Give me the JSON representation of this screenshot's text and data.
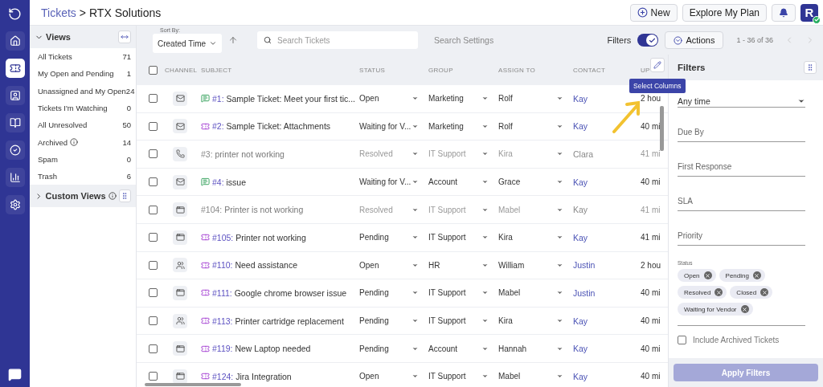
{
  "breadcrumb": {
    "parent": "Tickets",
    "separator": ">",
    "current": "RTX Solutions"
  },
  "header": {
    "new_button": "New",
    "plan_button": "Explore My Plan",
    "avatar": "R",
    "online": true
  },
  "rail": [
    {
      "kind": "home",
      "selected": false
    },
    {
      "kind": "tickets",
      "selected": true
    },
    {
      "kind": "contacts",
      "selected": false
    },
    {
      "kind": "book",
      "selected": false
    },
    {
      "kind": "tasks",
      "selected": false
    },
    {
      "kind": "reports",
      "selected": false
    },
    {
      "kind": "settings",
      "selected": false
    }
  ],
  "views": {
    "title": "Views",
    "expanded": true,
    "items": [
      {
        "label": "All Tickets",
        "count": "71",
        "info": false
      },
      {
        "label": "My Open and Pending",
        "count": "1",
        "info": false
      },
      {
        "label": "Unassigned and My Open",
        "count": "24",
        "info": false
      },
      {
        "label": "Tickets I'm Watching",
        "count": "0",
        "info": false
      },
      {
        "label": "All Unresolved",
        "count": "50",
        "info": false
      },
      {
        "label": "Archived",
        "count": "14",
        "info": true
      },
      {
        "label": "Spam",
        "count": "0",
        "info": false
      },
      {
        "label": "Trash",
        "count": "6",
        "info": false
      }
    ],
    "custom_title": "Custom Views",
    "custom_expanded": false
  },
  "toolbar": {
    "sort_label": "Sort By:",
    "sort_value": "Created Time",
    "search_placeholder": "Search Tickets",
    "search_settings": "Search Settings",
    "filters_label": "Filters",
    "filters_on": true,
    "actions": "Actions",
    "pagination": "1 - 36 of 36"
  },
  "table": {
    "select_all_checked": false,
    "columns": [
      "CHANNEL",
      "SUBJECT",
      "STATUS",
      "GROUP",
      "ASSIGN TO",
      "CONTACT",
      "UP"
    ],
    "rows": [
      {
        "checked": false,
        "channel": {
          "kind": "mail"
        },
        "source": {
          "kind": "chat"
        },
        "number": "#1:",
        "title": "Sample Ticket: Meet your first tic...",
        "status": "Open",
        "group": "Marketing",
        "assignee": "Rolf",
        "contact": "Kay",
        "updated": "2 hou",
        "dimmed": false
      },
      {
        "checked": false,
        "channel": {
          "kind": "mail"
        },
        "source": {
          "kind": "ticket"
        },
        "number": "#2:",
        "title": "Sample Ticket: Attachments",
        "status": "Waiting for V...",
        "group": "Marketing",
        "assignee": "Rolf",
        "contact": "Kay",
        "updated": "40 mi",
        "dimmed": false
      },
      {
        "checked": false,
        "channel": {
          "kind": "phone"
        },
        "number": "#3:",
        "title": "printer not working",
        "status": "Resolved",
        "group": "IT Support",
        "assignee": "Kira",
        "contact": "Clara",
        "updated": "41 mi",
        "dimmed": true
      },
      {
        "checked": false,
        "channel": {
          "kind": "mail"
        },
        "source": {
          "kind": "chat"
        },
        "number": "#4:",
        "title": "issue",
        "status": "Waiting for V...",
        "group": "Account",
        "assignee": "Grace",
        "contact": "Kay",
        "updated": "40 mi",
        "dimmed": false
      },
      {
        "checked": false,
        "channel": {
          "kind": "web"
        },
        "number": "#104:",
        "title": "Printer is not working",
        "status": "Resolved",
        "group": "IT Support",
        "assignee": "Mabel",
        "contact": "Kay",
        "updated": "41 mi",
        "dimmed": true
      },
      {
        "checked": false,
        "channel": {
          "kind": "web"
        },
        "source": {
          "kind": "ticket"
        },
        "number": "#105:",
        "title": "Printer not working",
        "status": "Pending",
        "group": "IT Support",
        "assignee": "Kira",
        "contact": "Kay",
        "updated": "41 mi",
        "dimmed": false
      },
      {
        "checked": false,
        "channel": {
          "kind": "teams"
        },
        "source": {
          "kind": "ticket"
        },
        "number": "#110:",
        "title": "Need assistance",
        "status": "Open",
        "group": "HR",
        "assignee": "William",
        "contact": "Justin",
        "updated": "2 hou",
        "dimmed": false
      },
      {
        "checked": false,
        "channel": {
          "kind": "web"
        },
        "source": {
          "kind": "ticket"
        },
        "number": "#111:",
        "title": "Google chrome browser issue",
        "status": "Pending",
        "group": "IT Support",
        "assignee": "Mabel",
        "contact": "Justin",
        "updated": "40 mi",
        "dimmed": false
      },
      {
        "checked": false,
        "channel": {
          "kind": "teams"
        },
        "source": {
          "kind": "ticket"
        },
        "number": "#113:",
        "title": "Printer cartridge replacement",
        "status": "Pending",
        "group": "IT Support",
        "assignee": "Kira",
        "contact": "Kay",
        "updated": "40 mi",
        "dimmed": false
      },
      {
        "checked": false,
        "channel": {
          "kind": "web"
        },
        "source": {
          "kind": "ticket"
        },
        "number": "#119:",
        "title": "New Laptop needed",
        "status": "Pending",
        "group": "Account",
        "assignee": "Hannah",
        "contact": "Kay",
        "updated": "40 mi",
        "dimmed": false
      },
      {
        "checked": false,
        "channel": {
          "kind": "web"
        },
        "source": {
          "kind": "ticket"
        },
        "number": "#124:",
        "title": "Jira Integration",
        "status": "Open",
        "group": "IT Support",
        "assignee": "Mabel",
        "contact": "Kay",
        "updated": "40 mi",
        "dimmed": false
      }
    ]
  },
  "tooltip": "Select Columns",
  "filters": {
    "title": "Filters",
    "created_value": "Any time",
    "fields": [
      {
        "placeholder": "Due By"
      },
      {
        "placeholder": "First Response"
      },
      {
        "placeholder": "SLA"
      },
      {
        "placeholder": "Priority"
      }
    ],
    "status_label": "Status",
    "status_chips": [
      "Open",
      "Pending",
      "Resolved",
      "Closed",
      "Waiting for Vendor"
    ],
    "archived_label": "Include Archived Tickets",
    "archived_checked": false,
    "apply": "Apply Filters",
    "apply_disabled": true
  }
}
